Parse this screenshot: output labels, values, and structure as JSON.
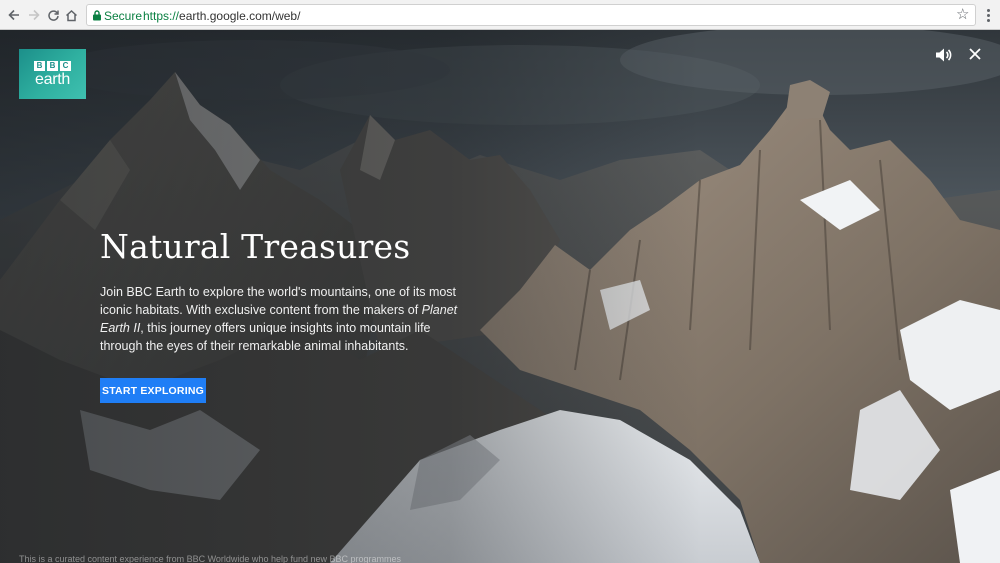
{
  "browser": {
    "secure_label": "Secure",
    "url_scheme": "https://",
    "url_rest": "earth.google.com/web/"
  },
  "colors": {
    "cta_bg": "#1f7ef6",
    "secure_green": "#0b8043",
    "logo_teal": "#1c8f8a"
  },
  "logo": {
    "letters": [
      "B",
      "B",
      "C"
    ],
    "wordmark": "earth"
  },
  "icons": {
    "back": "back-arrow-icon",
    "forward": "forward-arrow-icon",
    "reload": "reload-icon",
    "home": "home-icon",
    "lock": "lock-icon",
    "bookmark": "star-icon",
    "menu": "menu-dots-icon",
    "sound": "speaker-icon",
    "close": "close-icon"
  },
  "hero": {
    "title": "Natural Treasures",
    "desc_before": "Join BBC Earth to explore the world's mountains, one of its most iconic habitats. With exclusive content from the makers of ",
    "desc_em": "Planet Earth II",
    "desc_after": ", this journey offers unique insights into mountain life through the eyes of their remarkable animal inhabitants.",
    "cta": "START EXPLORING",
    "footer_note": "This is a curated content experience from BBC Worldwide who help fund new BBC programmes"
  }
}
